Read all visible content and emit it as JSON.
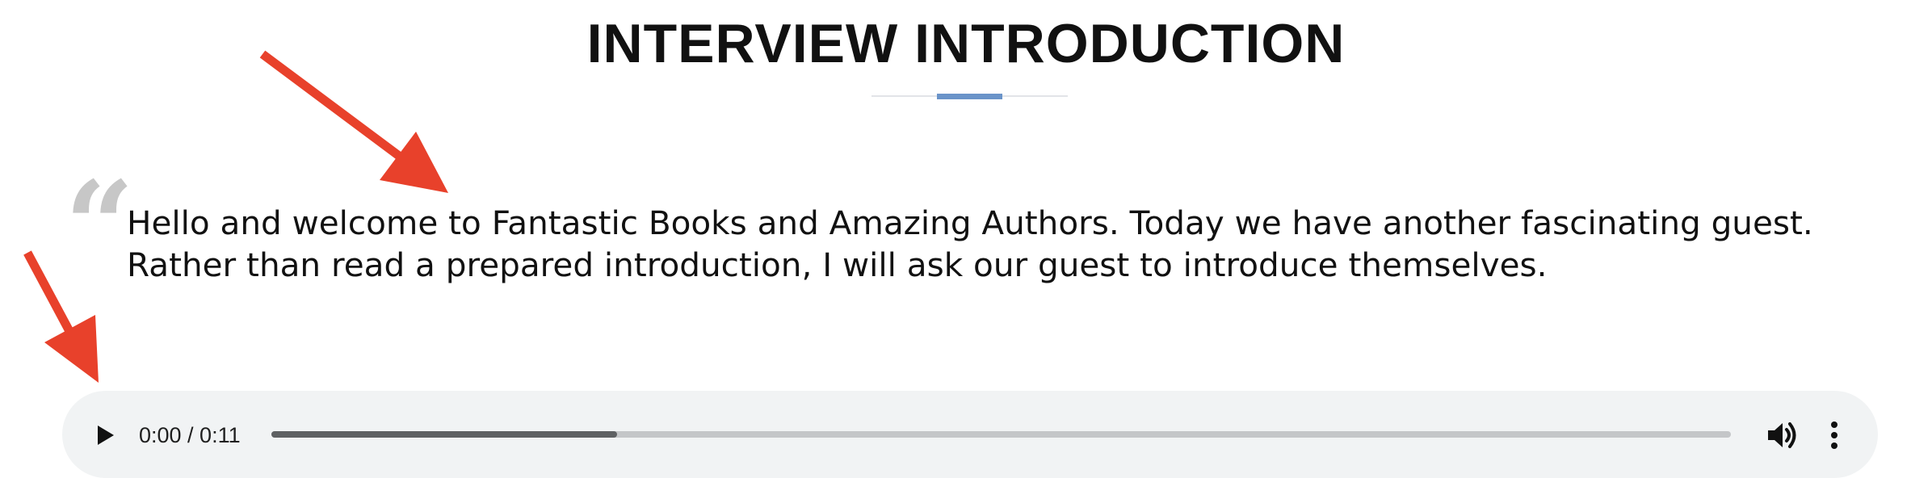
{
  "section": {
    "title": "INTERVIEW INTRODUCTION"
  },
  "quote": {
    "mark": "“",
    "text": "Hello and welcome to Fantastic Books and Amazing Authors. Today we have another fascinating guest. Rather than read a prepared introduction, I will ask our guest to introduce themselves."
  },
  "audio_player": {
    "time": "0:00 / 0:11",
    "buffered_fraction": 0.237,
    "icons": {
      "play": "play-icon",
      "volume": "volume-icon",
      "more": "more-vertical-icon"
    }
  },
  "colors": {
    "accent": "#6a93c9",
    "annotation_arrow": "#e8412b",
    "player_background": "#f1f3f4"
  }
}
